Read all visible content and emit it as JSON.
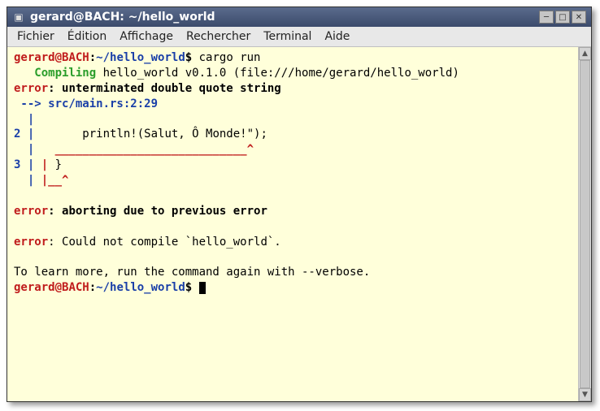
{
  "window": {
    "title": "gerard@BACH: ~/hello_world"
  },
  "menubar": {
    "items": [
      "Fichier",
      "Édition",
      "Affichage",
      "Rechercher",
      "Terminal",
      "Aide"
    ]
  },
  "prompt": {
    "user": "gerard",
    "at": "@",
    "host": "BACH",
    "colon": ":",
    "path": "~/hello_world",
    "dollar": "$"
  },
  "lines": {
    "cmd1": " cargo run",
    "compiling_label": "   Compiling",
    "compiling_rest": " hello_world v0.1.0 (file:///home/gerard/hello_world)",
    "err1_label": "error",
    "err1_rest": ": unterminated double quote string",
    "arrow": " --> src/main.rs:2:29",
    "pipe1": "  |",
    "line2num": "2",
    "line2pipe": " |",
    "line2code": "       println!(Salut, Ô Monde!\");",
    "line2under_pipe": "  | ",
    "line2under": "  ____________________________^",
    "line3num": "3",
    "line3pipe": " |",
    "line3redpipe": " |",
    "line3code": " }",
    "line3under_pipe": "  | ",
    "line3under": "|__^",
    "err2_label": "error",
    "err2_rest": ": aborting due to previous error",
    "err3_label": "error",
    "err3_rest": ": Could not compile `hello_world`.",
    "learn": "To learn more, run the command again with --verbose."
  }
}
